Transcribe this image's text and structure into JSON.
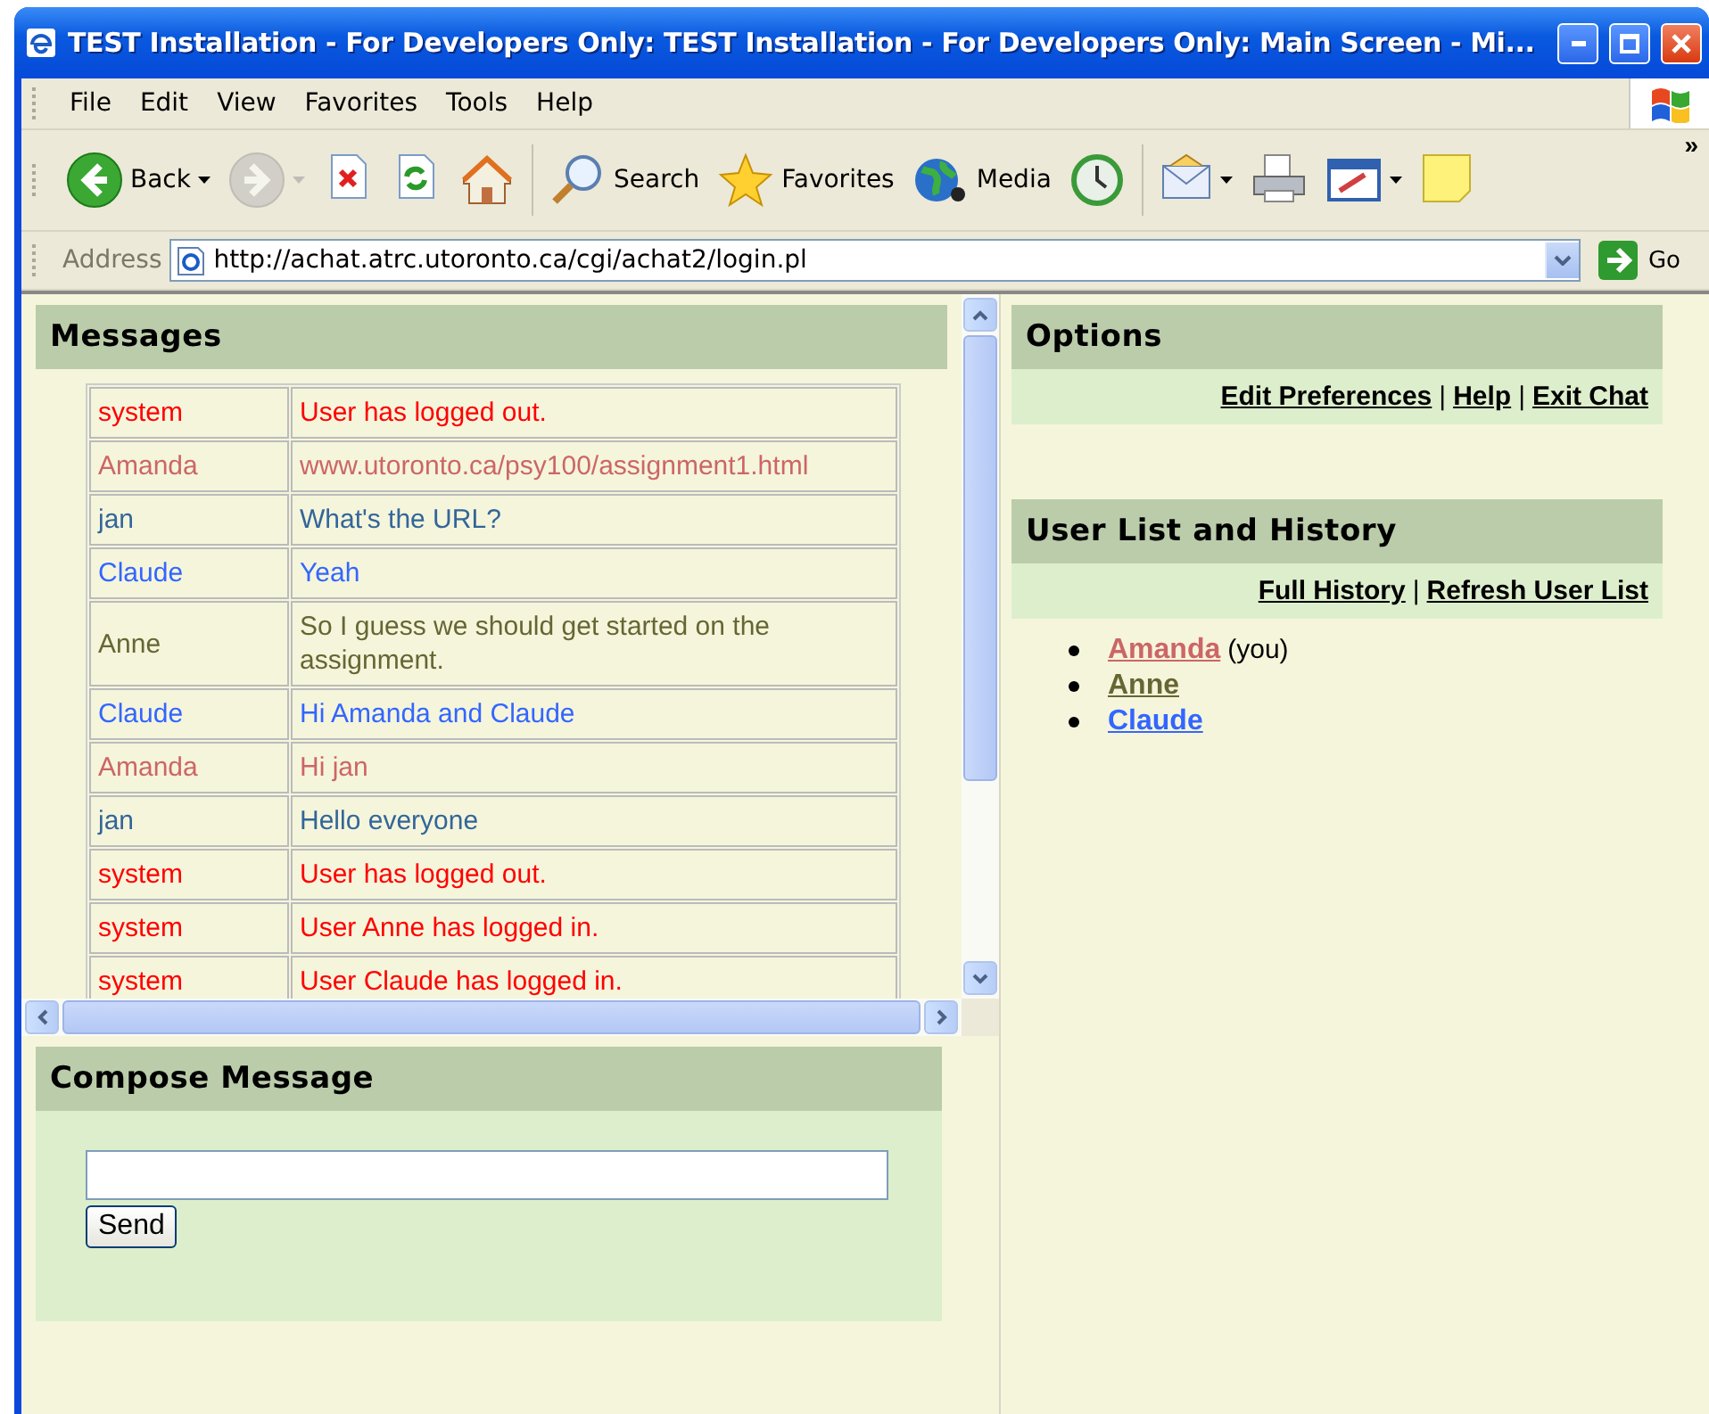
{
  "window": {
    "title": "TEST Installation - For Developers Only: TEST Installation - For Developers Only: Main Screen - Mi..."
  },
  "menu": [
    "File",
    "Edit",
    "View",
    "Favorites",
    "Tools",
    "Help"
  ],
  "toolbar": [
    {
      "kind": "back",
      "label": "Back",
      "dropdown": true,
      "disabled": false
    },
    {
      "kind": "forward",
      "dropdown": true,
      "disabled": true
    },
    {
      "kind": "stop",
      "dropdown": false,
      "disabled": false
    },
    {
      "kind": "refresh",
      "dropdown": false,
      "disabled": false
    },
    {
      "kind": "home",
      "dropdown": false,
      "disabled": false
    },
    {
      "kind": "search",
      "label": "Search",
      "dropdown": false,
      "disabled": false
    },
    {
      "kind": "favorites",
      "label": "Favorites",
      "dropdown": false,
      "disabled": false
    },
    {
      "kind": "media",
      "label": "Media",
      "dropdown": false,
      "disabled": false
    },
    {
      "kind": "history",
      "dropdown": false,
      "disabled": false
    },
    {
      "kind": "mail",
      "dropdown": true,
      "disabled": false
    },
    {
      "kind": "print",
      "dropdown": false,
      "disabled": false
    },
    {
      "kind": "edit",
      "dropdown": true,
      "disabled": false
    },
    {
      "kind": "notes",
      "dropdown": false,
      "disabled": false
    }
  ],
  "toolbar_overflow": "»",
  "address": {
    "label": "Address",
    "url": "http://achat.atrc.utoronto.ca/cgi/achat2/login.pl",
    "go": "Go"
  },
  "messages": {
    "title": "Messages",
    "rows": [
      {
        "sender": "system",
        "text": "User has logged out.",
        "color": "#ff0000"
      },
      {
        "sender": "Amanda",
        "text": "www.utoronto.ca/psy100/assignment1.html",
        "color": "#cc6666"
      },
      {
        "sender": "jan",
        "text": "What's the URL?",
        "color": "#336699"
      },
      {
        "sender": "Claude",
        "text": "Yeah",
        "color": "#3366ff"
      },
      {
        "sender": "Anne",
        "text": "So I guess we should get started on the assignment.",
        "color": "#666633"
      },
      {
        "sender": "Claude",
        "text": "Hi Amanda and Claude",
        "color": "#3366ff"
      },
      {
        "sender": "Amanda",
        "text": "Hi jan",
        "color": "#cc6666"
      },
      {
        "sender": "jan",
        "text": "Hello everyone",
        "color": "#336699"
      },
      {
        "sender": "system",
        "text": "User has logged out.",
        "color": "#ff0000"
      },
      {
        "sender": "system",
        "text": "User Anne has logged in.",
        "color": "#ff0000"
      },
      {
        "sender": "system",
        "text": "User Claude has logged in.",
        "color": "#ff0000"
      }
    ]
  },
  "options": {
    "title": "Options",
    "links": [
      "Edit Preferences",
      "Help",
      "Exit Chat"
    ],
    "separator": "|"
  },
  "user_list": {
    "title": "User List and History",
    "links": [
      "Full History",
      "Refresh User List"
    ],
    "separator": "|",
    "users": [
      {
        "name": "Amanda",
        "note": "(you)",
        "color": "#cc6666"
      },
      {
        "name": "Anne",
        "color": "#666633"
      },
      {
        "name": "Claude",
        "color": "#3366ff"
      }
    ]
  },
  "compose": {
    "title": "Compose Message",
    "send": "Send"
  }
}
